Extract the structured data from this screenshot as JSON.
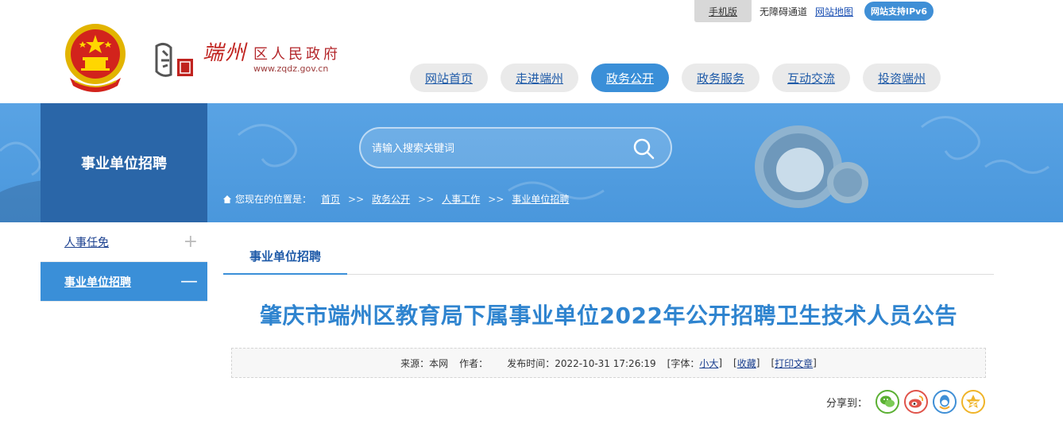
{
  "topbar": {
    "mobile_label": "手机版",
    "barrier_label": "无障碍通道",
    "sitemap_label": "网站地图",
    "ipv6_label": "网站支持IPv6"
  },
  "logo": {
    "name": "端州",
    "sub": "区人民政府",
    "url": "www.zqdz.gov.cn"
  },
  "nav": {
    "items": [
      {
        "label": "网站首页"
      },
      {
        "label": "走进端州"
      },
      {
        "label": "政务公开"
      },
      {
        "label": "政务服务"
      },
      {
        "label": "互动交流"
      },
      {
        "label": "投资端州"
      }
    ],
    "active_index": 2
  },
  "banner": {
    "section_title": "事业单位招聘",
    "search_placeholder": "请输入搜索关键词",
    "crumb_prefix": "您现在的位置是：",
    "crumbs": [
      "首页",
      "政务公开",
      "人事工作",
      "事业单位招聘"
    ],
    "crumb_sep": ">>"
  },
  "sidebar": {
    "items": [
      {
        "label": "人事任免",
        "symbol": "+"
      },
      {
        "label": "事业单位招聘",
        "symbol": "—"
      }
    ]
  },
  "content": {
    "tab_label": "事业单位招聘",
    "title": "肇庆市端州区教育局下属事业单位2022年公开招聘卫生技术人员公告",
    "meta": {
      "source": "来源：本网",
      "author": "作者：",
      "published": "发布时间：2022-10-31 17:26:19",
      "font_prefix": "[字体：",
      "font_small": "小",
      "font_large": "大",
      "font_suffix": "]",
      "bracket_open": "[",
      "bracket_close": "]",
      "favorite": "收藏",
      "print": "打印文章"
    },
    "share_label": "分享到："
  },
  "colors": {
    "accent": "#3a8fd8",
    "banner": "#4a97dc",
    "section_dark": "#2a66a8",
    "title": "#2f84cf",
    "link": "#1a3f8f"
  },
  "share_icons": [
    "wechat-icon",
    "weibo-icon",
    "qq-icon",
    "qzone-icon"
  ]
}
